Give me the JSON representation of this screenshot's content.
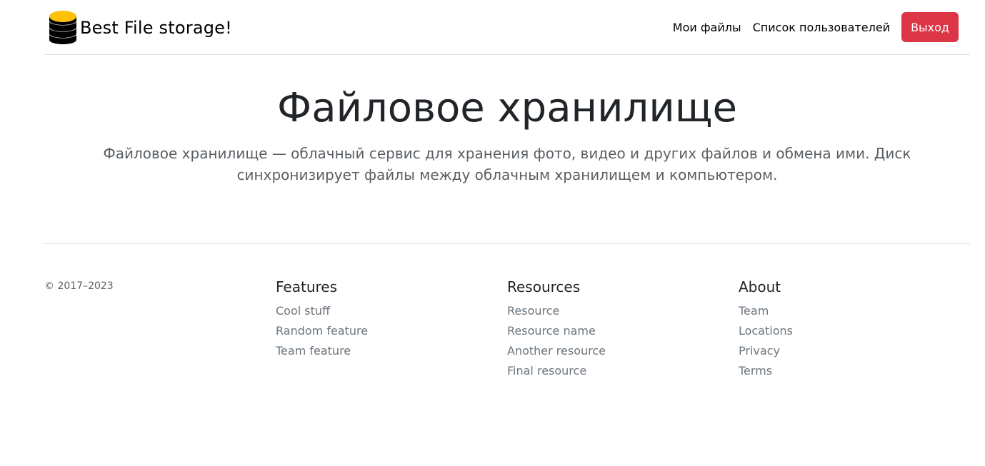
{
  "brand": {
    "name": "Best File storage!",
    "logo_icon": "database-icon",
    "logo_colors": {
      "top": "#ffc107",
      "body": "#000000"
    }
  },
  "nav": {
    "my_files": "Мои файлы",
    "users_list": "Список пользователей",
    "logout": "Выход",
    "logout_color": "#dc3545"
  },
  "hero": {
    "title": "Файловое хранилище",
    "lead": "Файловое хранилище — облачный сервис для хранения фото, видео и других файлов и обмена ими. Диск синхронизирует файлы между облачным хранилищем и компьютером."
  },
  "footer": {
    "copyright": "© 2017–2023",
    "columns": [
      {
        "heading": "Features",
        "links": [
          "Cool stuff",
          "Random feature",
          "Team feature"
        ]
      },
      {
        "heading": "Resources",
        "links": [
          "Resource",
          "Resource name",
          "Another resource",
          "Final resource"
        ]
      },
      {
        "heading": "About",
        "links": [
          "Team",
          "Locations",
          "Privacy",
          "Terms"
        ]
      }
    ]
  }
}
